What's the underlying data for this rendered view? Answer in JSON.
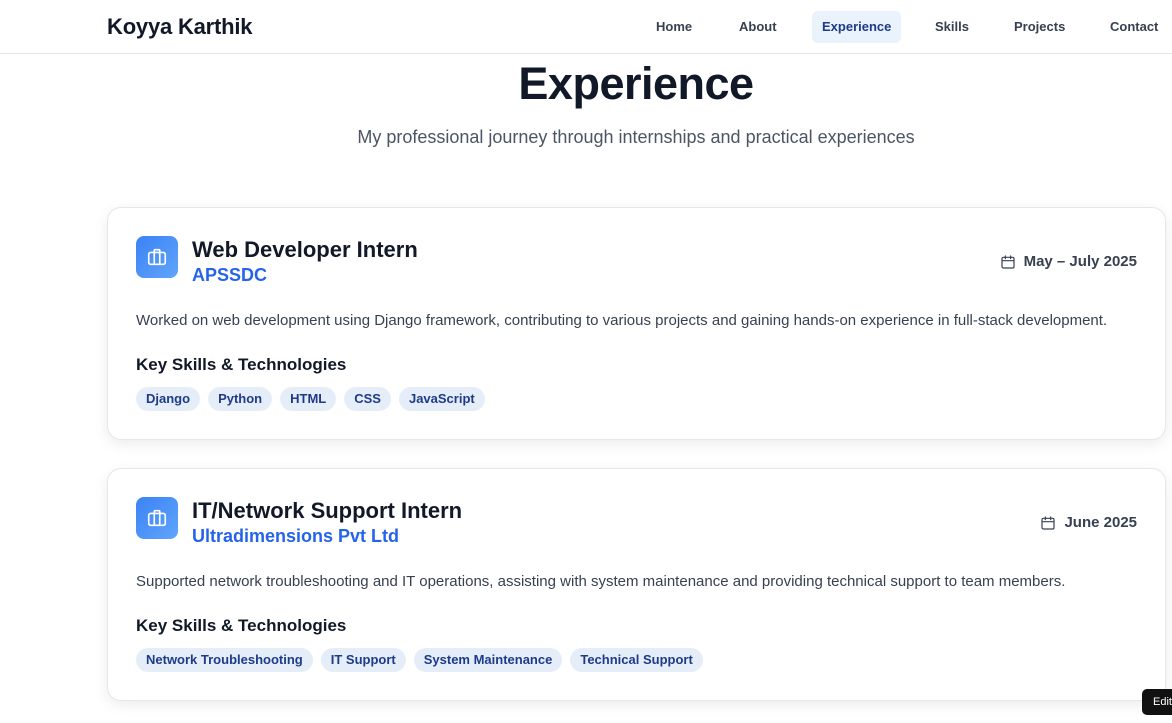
{
  "nav": {
    "brand": "Koyya Karthik",
    "links": [
      "Home",
      "About",
      "Experience",
      "Skills",
      "Projects",
      "Contact"
    ],
    "active": "Experience"
  },
  "section": {
    "title": "Experience",
    "subtitle": "My professional journey through internships and practical experiences"
  },
  "experiences": [
    {
      "icon": "briefcase-icon",
      "title": "Web Developer Intern",
      "company": "APSSDC",
      "date": "May – July 2025",
      "description": "Worked on web development using Django framework, contributing to various projects and gaining hands-on experience in full-stack development.",
      "skills_heading": "Key Skills & Technologies",
      "skills": [
        "Django",
        "Python",
        "HTML",
        "CSS",
        "JavaScript"
      ]
    },
    {
      "icon": "briefcase-icon",
      "title": "IT/Network Support Intern",
      "company": "Ultradimensions Pvt Ltd",
      "date": "June 2025",
      "description": "Supported network troubleshooting and IT operations, assisting with system maintenance and providing technical support to team members.",
      "skills_heading": "Key Skills & Technologies",
      "skills": [
        "Network Troubleshooting",
        "IT Support",
        "System Maintenance",
        "Technical Support"
      ]
    }
  ],
  "edit_badge": "Edit",
  "colors": {
    "accent": "#2563eb",
    "tag_bg": "#e5eef8",
    "tag_text": "#1e3a8a",
    "active_nav_bg": "#eaf2fb"
  }
}
